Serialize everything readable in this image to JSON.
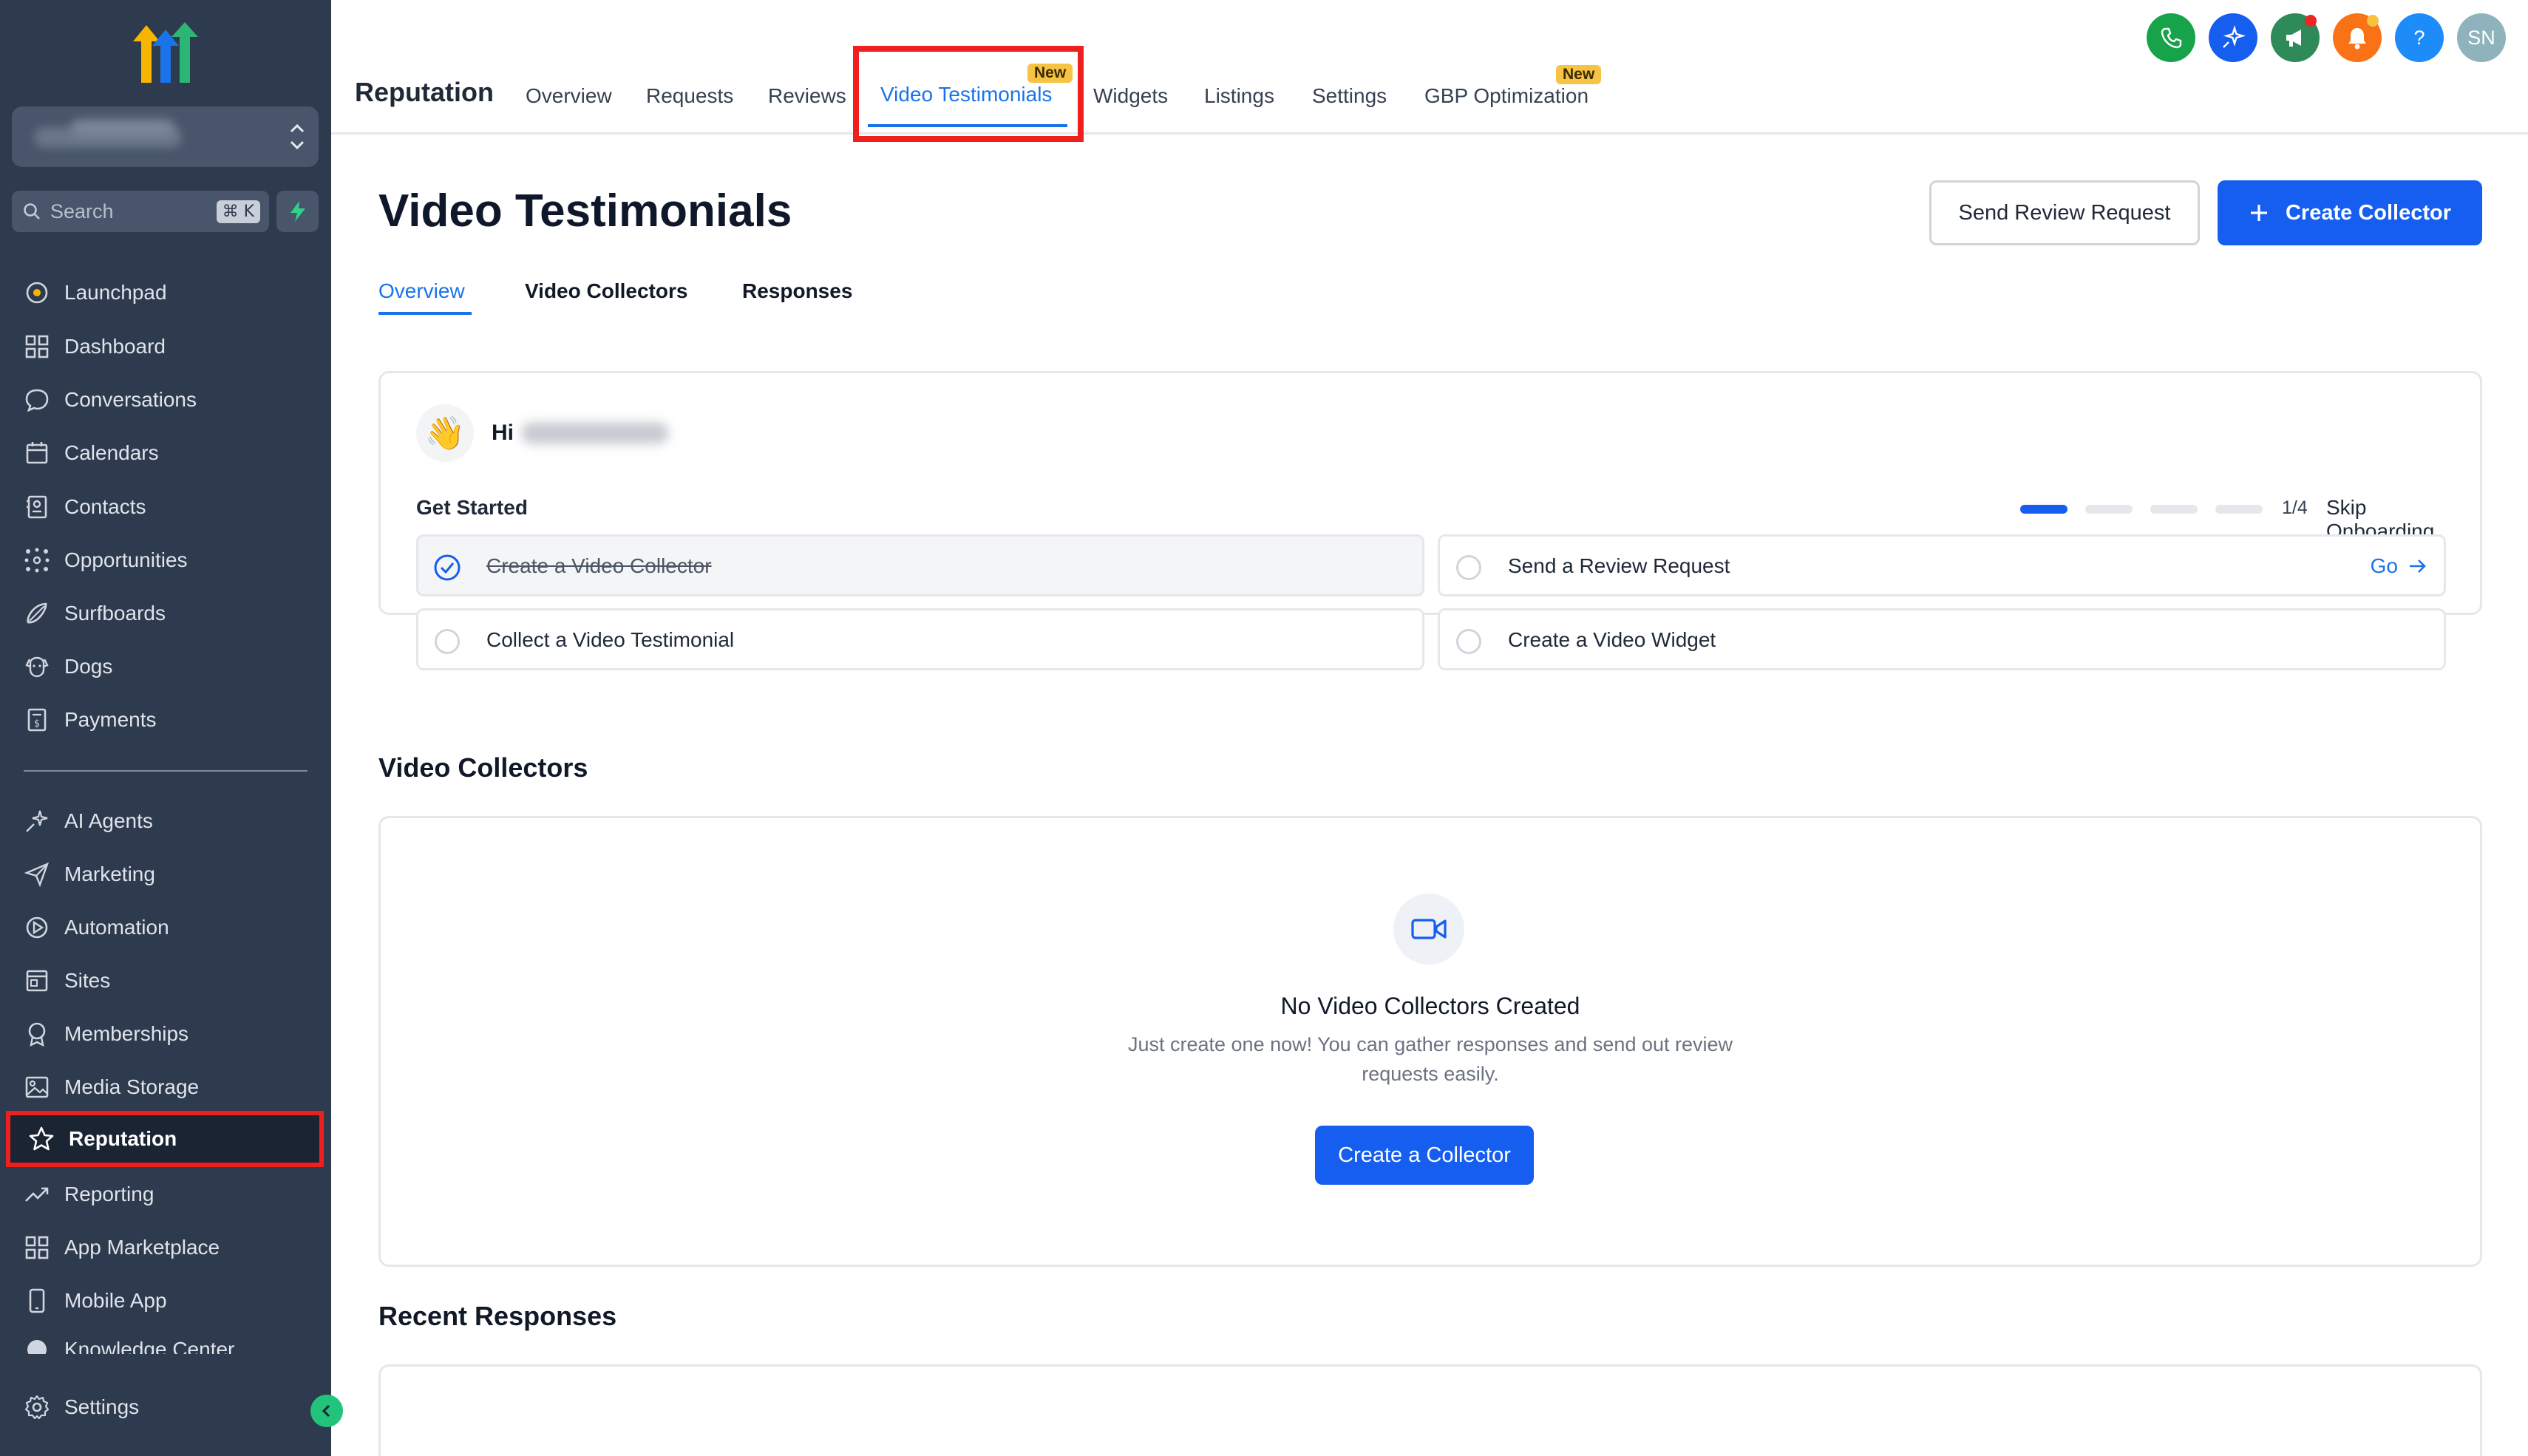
{
  "sidebar": {
    "search_placeholder": "Search",
    "search_shortcut": "⌘ K",
    "items_top": [
      {
        "label": "Launchpad",
        "icon": "launchpad-icon"
      },
      {
        "label": "Dashboard",
        "icon": "dashboard-icon"
      },
      {
        "label": "Conversations",
        "icon": "chat-icon"
      },
      {
        "label": "Calendars",
        "icon": "calendar-icon"
      },
      {
        "label": "Contacts",
        "icon": "contacts-icon"
      },
      {
        "label": "Opportunities",
        "icon": "opportunities-icon"
      },
      {
        "label": "Surfboards",
        "icon": "surfboard-icon"
      },
      {
        "label": "Dogs",
        "icon": "dog-icon"
      },
      {
        "label": "Payments",
        "icon": "payments-icon"
      }
    ],
    "items_bottom": [
      {
        "label": "AI Agents",
        "icon": "sparkle-icon"
      },
      {
        "label": "Marketing",
        "icon": "send-icon"
      },
      {
        "label": "Automation",
        "icon": "automation-icon"
      },
      {
        "label": "Sites",
        "icon": "sites-icon"
      },
      {
        "label": "Memberships",
        "icon": "award-icon"
      },
      {
        "label": "Media Storage",
        "icon": "image-icon"
      },
      {
        "label": "Reputation",
        "icon": "star-icon",
        "active": true
      },
      {
        "label": "Reporting",
        "icon": "trend-icon"
      },
      {
        "label": "App Marketplace",
        "icon": "apps-icon"
      },
      {
        "label": "Mobile App",
        "icon": "mobile-icon"
      },
      {
        "label": "Knowledge Center",
        "icon": "knowledge-icon"
      }
    ],
    "settings_label": "Settings"
  },
  "header": {
    "title": "Reputation",
    "tabs": [
      "Overview",
      "Requests",
      "Reviews",
      "Video Testimonials",
      "Widgets",
      "Listings",
      "Settings",
      "GBP Optimization"
    ],
    "active_tab": "Video Testimonials",
    "new_badge": "New",
    "avatar_initials": "SN",
    "help_glyph": "?"
  },
  "main": {
    "page_title": "Video Testimonials",
    "send_review_request": "Send Review Request",
    "create_collector": "Create Collector",
    "subtabs": [
      "Overview",
      "Video Collectors",
      "Responses"
    ],
    "active_subtab": "Overview",
    "onboarding": {
      "greeting": "Hi",
      "wave": "👋",
      "get_started": "Get Started",
      "step_count": "1/4",
      "skip": "Skip Onboarding",
      "progress_done": 1,
      "progress_total": 4,
      "steps": [
        {
          "label": "Create a Video Collector",
          "done": true
        },
        {
          "label": "Send a Review Request",
          "done": false,
          "action": "Go"
        },
        {
          "label": "Collect a Video Testimonial",
          "done": false
        },
        {
          "label": "Create a Video Widget",
          "done": false
        }
      ]
    },
    "collectors": {
      "title": "Video Collectors",
      "empty_title": "No Video Collectors Created",
      "empty_desc": "Just create one now! You can gather responses and send out review requests easily.",
      "empty_button": "Create a Collector"
    },
    "recent_responses_title": "Recent Responses"
  },
  "colors": {
    "sidebar_bg": "#2e3a4d",
    "accent": "#155eef",
    "highlight": "#ef1f1f",
    "badge": "#f6c344"
  }
}
